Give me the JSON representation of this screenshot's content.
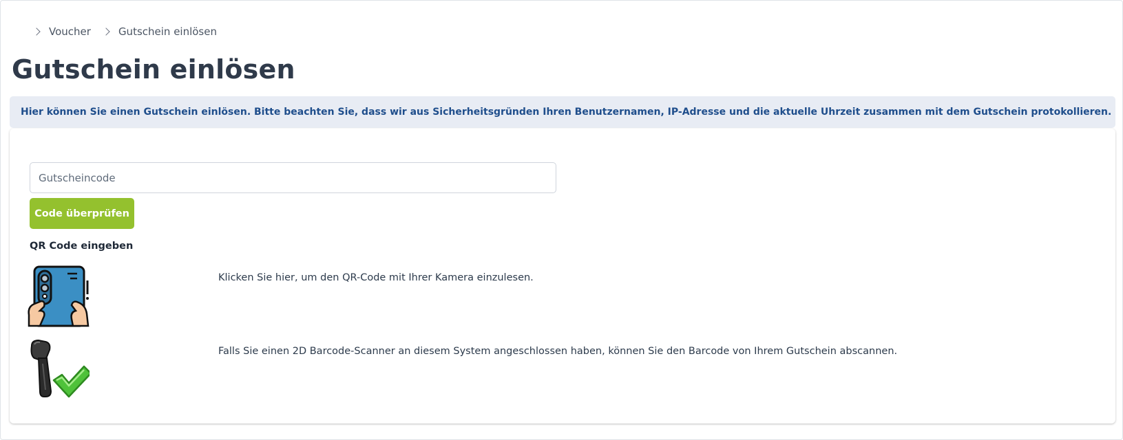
{
  "breadcrumb": {
    "items": [
      {
        "label": "Voucher"
      },
      {
        "label": "Gutschein einlösen"
      }
    ]
  },
  "page": {
    "title": "Gutschein einlösen"
  },
  "info_banner": {
    "text": "Hier können Sie einen Gutschein einlösen. Bitte beachten Sie, dass wir aus Sicherheitsgründen Ihren Benutzernamen, IP-Adresse und die aktuelle Uhrzeit zusammen mit dem Gutschein protokollieren."
  },
  "form": {
    "code_input": {
      "placeholder": "Gutscheincode",
      "value": ""
    },
    "check_button_label": "Code überprüfen",
    "accent_color": "#94c12e"
  },
  "qr_section": {
    "heading": "QR Code eingeben",
    "options": [
      {
        "icon": "phone-camera-icon",
        "text": "Klicken Sie hier, um den QR-Code mit Ihrer Kamera einzulesen."
      },
      {
        "icon": "barcode-scanner-check-icon",
        "text": "Falls Sie einen 2D Barcode-Scanner an diesem System angeschlossen haben, können Sie den Barcode von Ihrem Gutschein abscannen."
      }
    ]
  }
}
